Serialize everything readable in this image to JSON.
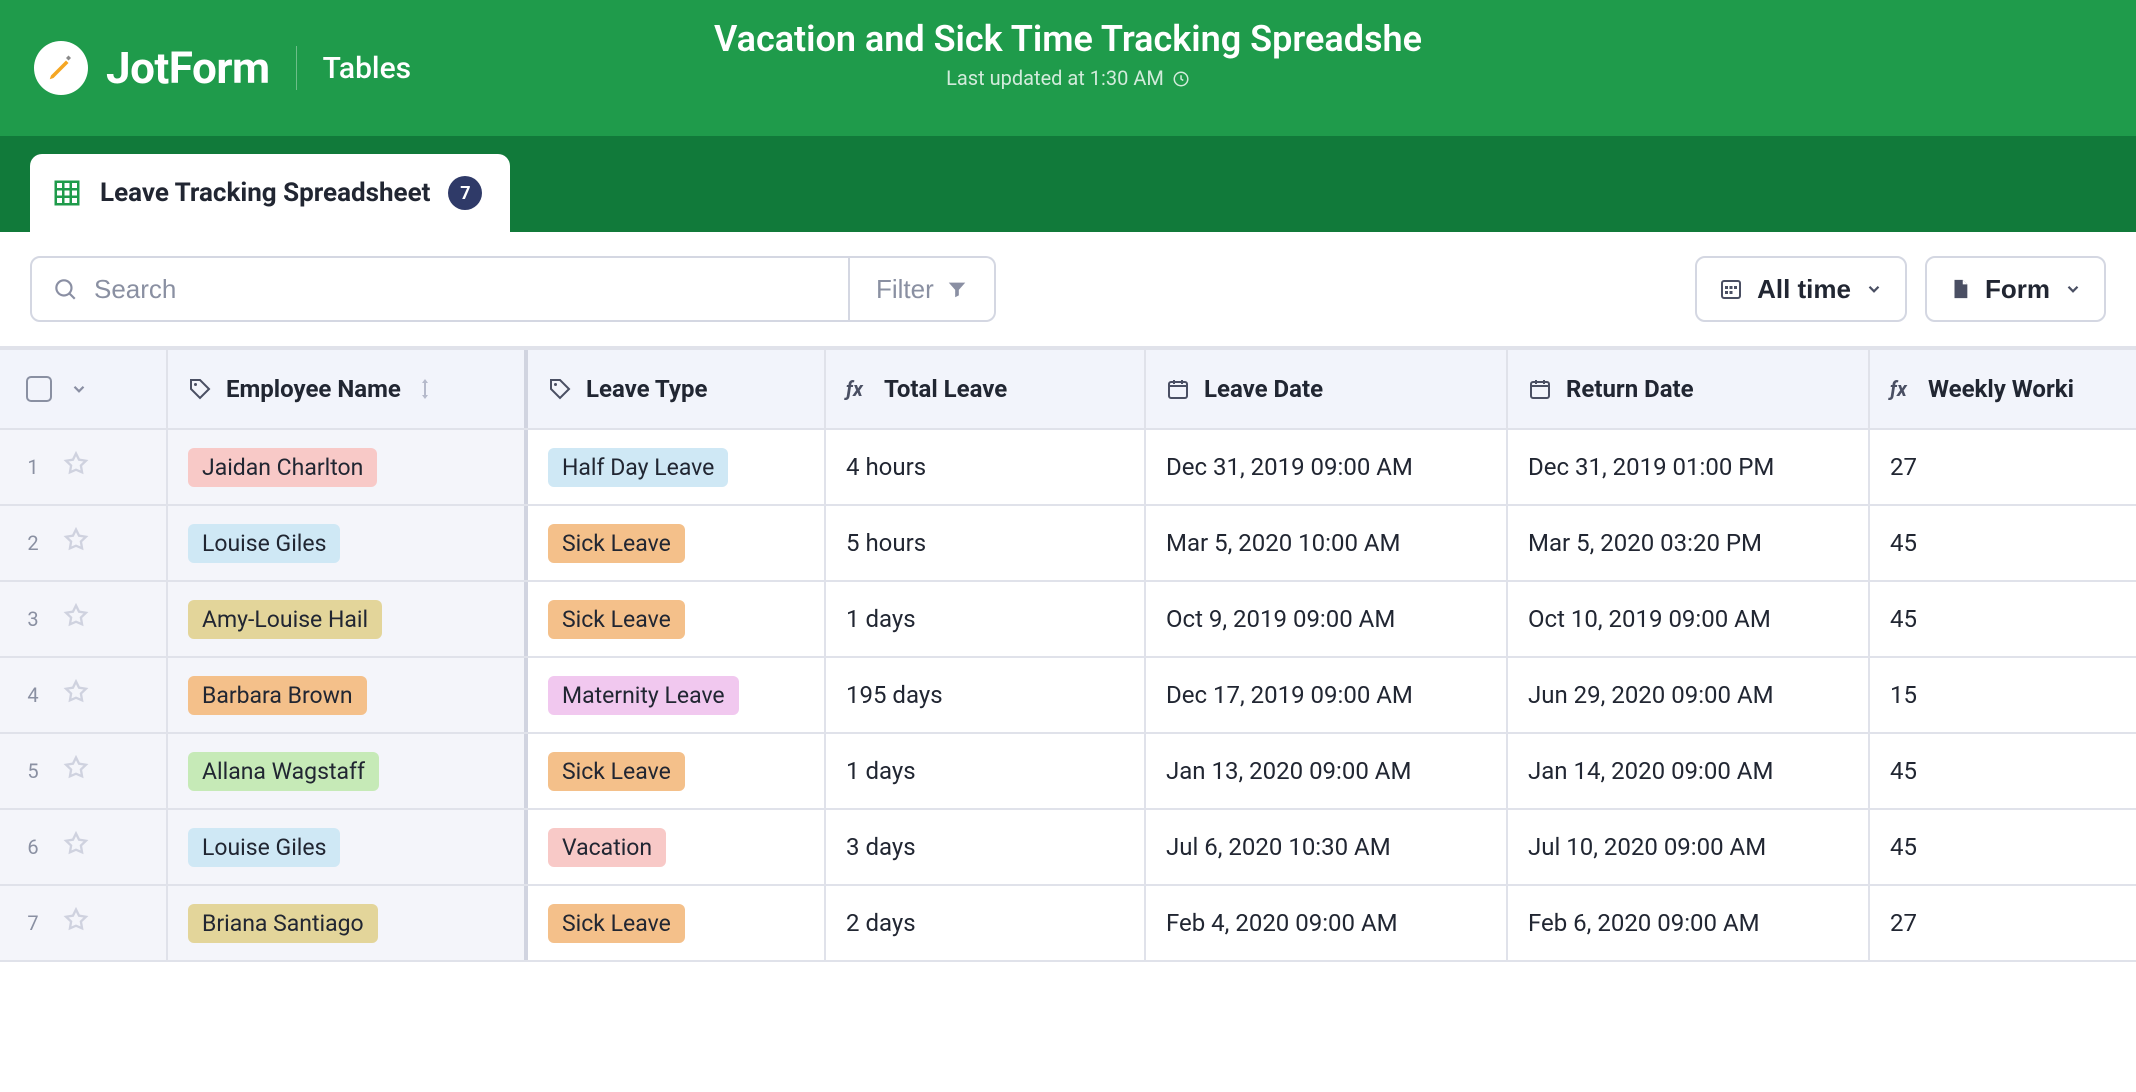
{
  "brand": {
    "name": "JotForm",
    "section": "Tables"
  },
  "header": {
    "title": "Vacation and Sick Time Tracking Spreadshe",
    "last_updated": "Last updated at 1:30 AM"
  },
  "tab": {
    "label": "Leave Tracking Spreadsheet",
    "count": "7"
  },
  "toolbar": {
    "search_placeholder": "Search",
    "filter_label": "Filter",
    "timerange_label": "All time",
    "form_label": "Form"
  },
  "columns": {
    "employee": "Employee Name",
    "leave_type": "Leave Type",
    "total_leave": "Total Leave",
    "leave_date": "Leave Date",
    "return_date": "Return Date",
    "weekly": "Weekly Worki"
  },
  "pill_colors": {
    "name": {
      "Jaidan Charlton": "pill-pink",
      "Louise Giles": "pill-blue",
      "Amy-Louise Hail": "pill-tan",
      "Barbara Brown": "pill-orange",
      "Allana Wagstaff": "pill-green",
      "Briana Santiago": "pill-tan"
    },
    "type": {
      "Half Day Leave": "pill-blue",
      "Sick Leave": "pill-orange",
      "Maternity Leave": "pill-purple",
      "Vacation": "pill-pink"
    }
  },
  "rows": [
    {
      "n": "1",
      "employee": "Jaidan Charlton",
      "type": "Half Day Leave",
      "total": "4 hours",
      "leave": "Dec 31, 2019 09:00 AM",
      "return": "Dec 31, 2019 01:00 PM",
      "weekly": "27"
    },
    {
      "n": "2",
      "employee": "Louise Giles",
      "type": "Sick Leave",
      "total": "5 hours",
      "leave": "Mar 5, 2020 10:00 AM",
      "return": "Mar 5, 2020 03:20 PM",
      "weekly": "45"
    },
    {
      "n": "3",
      "employee": "Amy-Louise Hail",
      "type": "Sick Leave",
      "total": "1 days",
      "leave": "Oct 9, 2019 09:00 AM",
      "return": "Oct 10, 2019 09:00 AM",
      "weekly": "45"
    },
    {
      "n": "4",
      "employee": "Barbara Brown",
      "type": "Maternity Leave",
      "total": "195 days",
      "leave": "Dec 17, 2019 09:00 AM",
      "return": "Jun 29, 2020 09:00 AM",
      "weekly": "15"
    },
    {
      "n": "5",
      "employee": "Allana Wagstaff",
      "type": "Sick Leave",
      "total": "1 days",
      "leave": "Jan 13, 2020 09:00 AM",
      "return": "Jan 14, 2020 09:00 AM",
      "weekly": "45"
    },
    {
      "n": "6",
      "employee": "Louise Giles",
      "type": "Vacation",
      "total": "3 days",
      "leave": "Jul 6, 2020 10:30 AM",
      "return": "Jul 10, 2020 09:00 AM",
      "weekly": "45"
    },
    {
      "n": "7",
      "employee": "Briana Santiago",
      "type": "Sick Leave",
      "total": "2 days",
      "leave": "Feb 4, 2020 09:00 AM",
      "return": "Feb 6, 2020 09:00 AM",
      "weekly": "27"
    }
  ]
}
